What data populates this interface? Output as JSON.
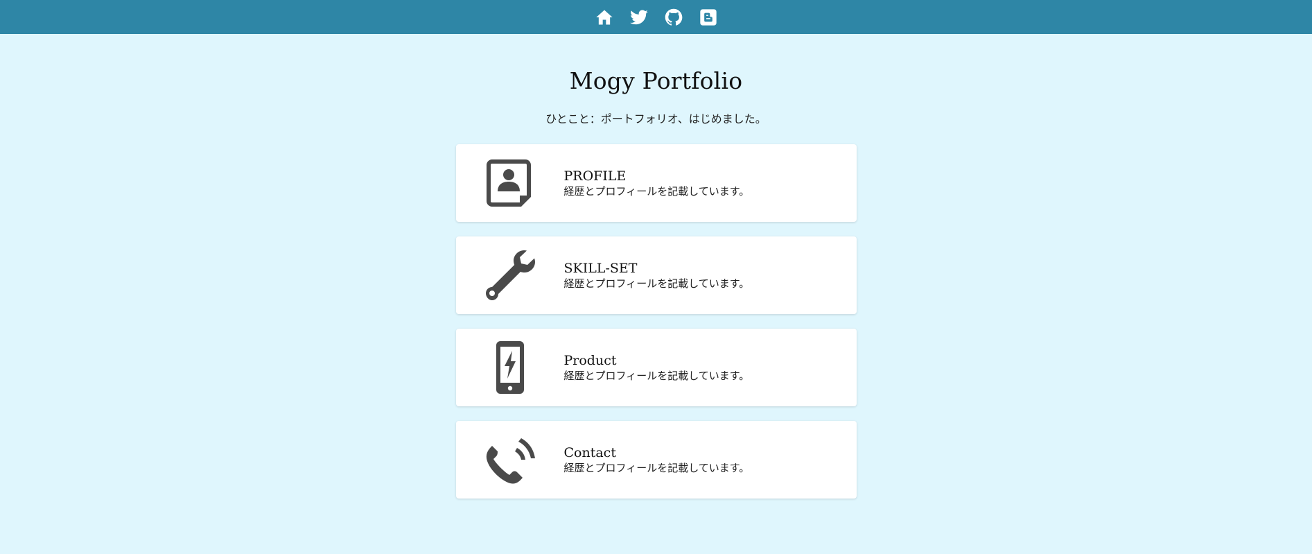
{
  "nav": {
    "items": [
      {
        "icon": "home-icon"
      },
      {
        "icon": "twitter-icon"
      },
      {
        "icon": "github-icon"
      },
      {
        "icon": "blogger-icon"
      }
    ]
  },
  "colors": {
    "topbar": "#2e86a6",
    "background": "#dff6fd",
    "card": "#ffffff",
    "icon": "#4a4a4a"
  },
  "header": {
    "title": "Mogy Portfolio",
    "tagline": "ひとこと：ポートフォリオ、はじめました。"
  },
  "cards": [
    {
      "icon": "profile-card-icon",
      "title": "PROFILE",
      "description": "経歴とプロフィールを記載しています。"
    },
    {
      "icon": "wrench-icon",
      "title": "SKILL-SET",
      "description": "経歴とプロフィールを記載しています。"
    },
    {
      "icon": "smartphone-bolt-icon",
      "title": "Product",
      "description": "経歴とプロフィールを記載しています。"
    },
    {
      "icon": "phone-call-icon",
      "title": "Contact",
      "description": "経歴とプロフィールを記載しています。"
    }
  ]
}
